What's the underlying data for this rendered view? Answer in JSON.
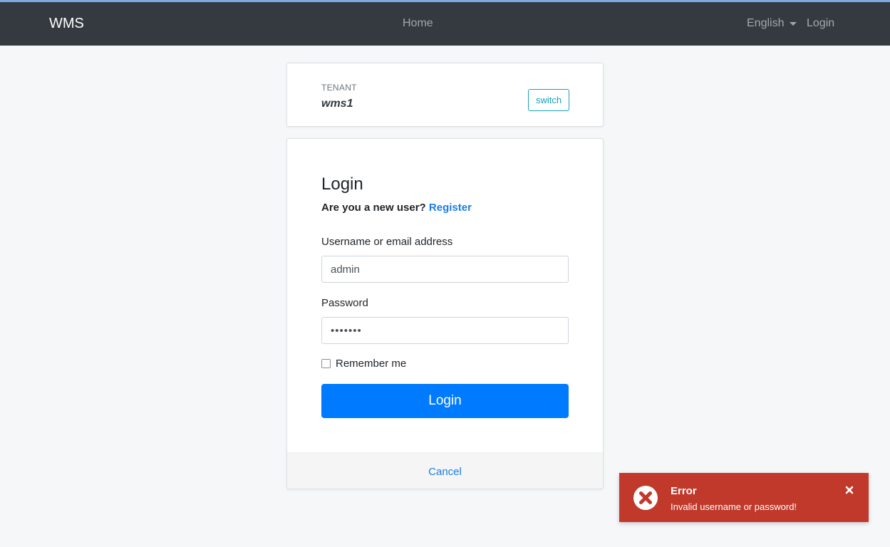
{
  "navbar": {
    "brand": "WMS",
    "home_label": "Home",
    "language_label": "English",
    "login_label": "Login"
  },
  "tenant": {
    "label": "TENANT",
    "name": "wms1",
    "switch_label": "switch"
  },
  "login_form": {
    "title": "Login",
    "new_user_text": "Are you a new user?",
    "register_label": "Register",
    "username_label": "Username or email address",
    "username_value": "admin",
    "password_label": "Password",
    "password_value": "•••••••",
    "remember_label": "Remember me",
    "remember_checked": false,
    "submit_label": "Login",
    "cancel_label": "Cancel"
  },
  "toast": {
    "title": "Error",
    "message": "Invalid username or password!",
    "icon": "error-x-circle-icon",
    "color": "#c0392b"
  },
  "colors": {
    "navbar": "#343a40",
    "primary": "#007bff",
    "link": "#1a7ee6",
    "accent_strip": "#7fa7e0"
  }
}
